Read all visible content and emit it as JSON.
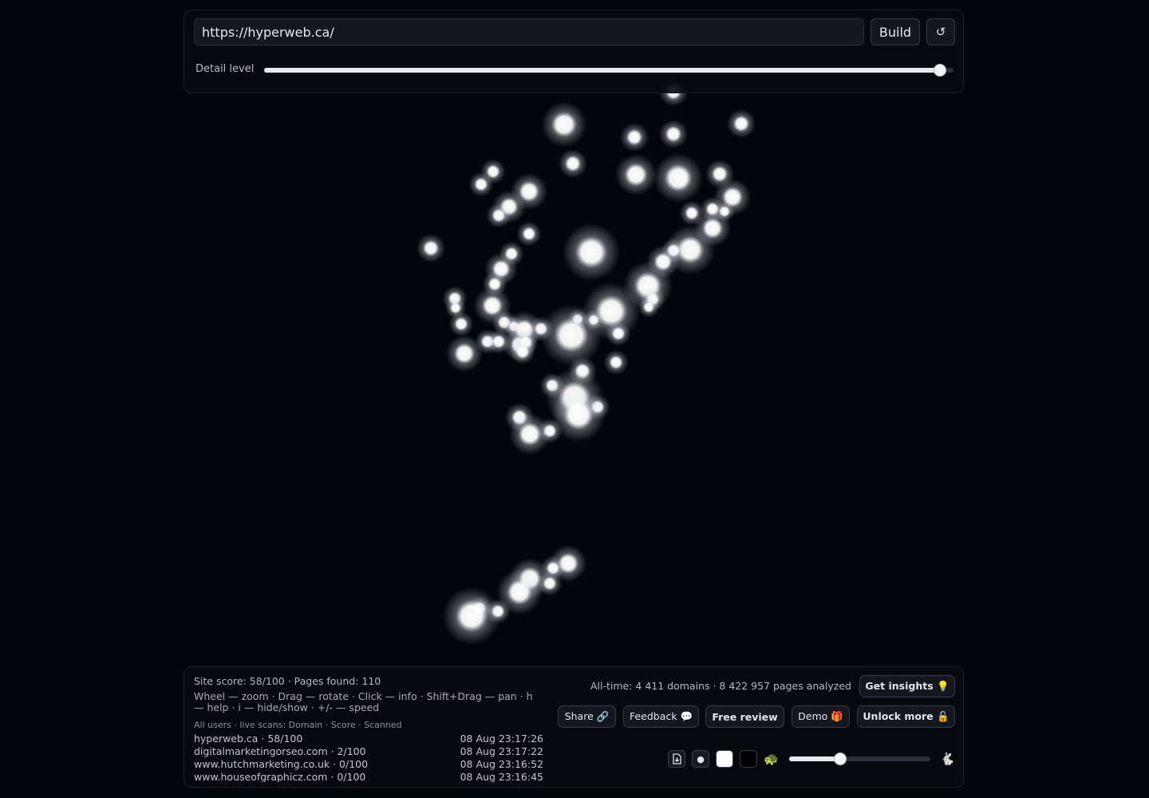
{
  "search": {
    "url_value": "https://hyperweb.ca/",
    "build_label": "Build",
    "reset_label": "↺"
  },
  "detail": {
    "label": "Detail level",
    "value_fraction": 0.98
  },
  "stats": {
    "score_line": "Site score: 58/100 · Pages found: 110",
    "help_line": "Wheel — zoom · Drag — rotate · Click — info · Shift+Drag — pan · h — help · i — hide/show · +/- — speed",
    "alltime": "All-time: 4 411 domains · 8 422 957 pages analyzed"
  },
  "scans": {
    "title": "All users · live scans: Domain · Score · Scanned",
    "rows": [
      {
        "domain": "hyperweb.ca · 58/100",
        "time": "08 Aug 23:17:26"
      },
      {
        "domain": "digitalmarketingorseo.com · 2/100",
        "time": "08 Aug 23:17:22"
      },
      {
        "domain": "www.hutchmarketing.co.uk · 0/100",
        "time": "08 Aug 23:16:52"
      },
      {
        "domain": "www.houseofgraphicz.com · 0/100",
        "time": "08 Aug 23:16:45"
      }
    ]
  },
  "actions": {
    "get_insights": "Get insights 💡",
    "share": "Share 🔗",
    "feedback": "Feedback 💬",
    "free_review": "Free review",
    "demo": "Demo 🎁",
    "unlock_more": "Unlock more 🔓"
  },
  "controls": {
    "download_icon": "download-icon",
    "dot_icon": "●",
    "white_swatch": "#ffffff",
    "black_swatch": "#000000",
    "slow_icon": "🐢",
    "fast_icon": "🐇",
    "speed_fraction": 0.36
  },
  "colors": {
    "background": "#04050a",
    "node": "#ffffff"
  }
}
